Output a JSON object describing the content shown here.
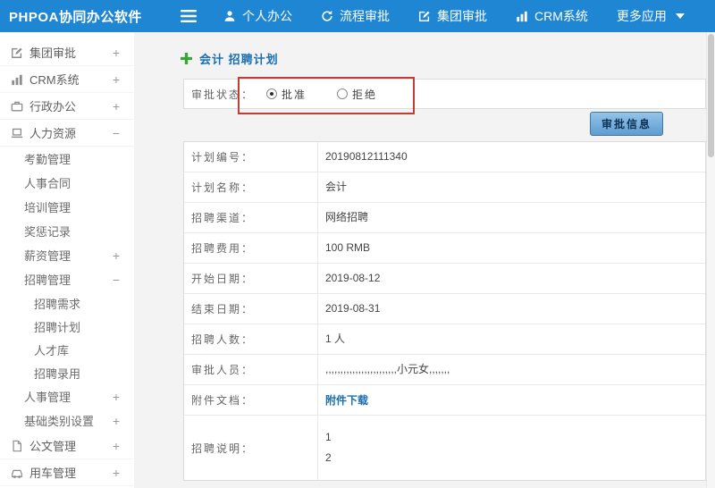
{
  "app": {
    "title": "PHPOA协同办公软件"
  },
  "topnav": {
    "items": [
      {
        "id": "personal-office",
        "label": "个人办公",
        "icon": "person-icon"
      },
      {
        "id": "workflow-approval",
        "label": "流程审批",
        "icon": "flow-icon"
      },
      {
        "id": "group-approval",
        "label": "集团审批",
        "icon": "edit-square-icon"
      },
      {
        "id": "crm-system",
        "label": "CRM系统",
        "icon": "bar-chart-icon"
      },
      {
        "id": "more-apps",
        "label": "更多应用",
        "caret": true
      }
    ]
  },
  "sidebar": {
    "items": [
      {
        "id": "group-approval",
        "label": "集团审批",
        "icon": "edit-square-icon",
        "toggle": "+",
        "level": 0
      },
      {
        "id": "crm-system",
        "label": "CRM系统",
        "icon": "bar-chart-icon",
        "toggle": "+",
        "level": 0
      },
      {
        "id": "admin-office",
        "label": "行政办公",
        "icon": "briefcase-icon",
        "toggle": "+",
        "level": 0
      },
      {
        "id": "human-resources",
        "label": "人力资源",
        "icon": "laptop-icon",
        "toggle": "−",
        "level": 0
      },
      {
        "id": "attendance-mgmt",
        "label": "考勤管理",
        "level": 1
      },
      {
        "id": "personnel-contract",
        "label": "人事合同",
        "level": 1
      },
      {
        "id": "training-mgmt",
        "label": "培训管理",
        "level": 1
      },
      {
        "id": "reward-punish-records",
        "label": "奖惩记录",
        "level": 1
      },
      {
        "id": "salary-mgmt",
        "label": "薪资管理",
        "toggle": "+",
        "level": 1
      },
      {
        "id": "recruit-mgmt",
        "label": "招聘管理",
        "toggle": "−",
        "level": 1
      },
      {
        "id": "recruit-demand",
        "label": "招聘需求",
        "level": 2
      },
      {
        "id": "recruit-plan",
        "label": "招聘计划",
        "level": 2
      },
      {
        "id": "talent-pool",
        "label": "人才库",
        "level": 2
      },
      {
        "id": "recruit-hire",
        "label": "招聘录用",
        "level": 2
      },
      {
        "id": "personnel-mgmt",
        "label": "人事管理",
        "toggle": "+",
        "level": 1
      },
      {
        "id": "base-category-settings",
        "label": "基础类别设置",
        "toggle": "+",
        "level": 1
      },
      {
        "id": "document-mgmt",
        "label": "公文管理",
        "icon": "document-icon",
        "toggle": "+",
        "level": 0
      },
      {
        "id": "vehicle-mgmt",
        "label": "用车管理",
        "icon": "car-icon",
        "toggle": "+",
        "level": 0
      }
    ]
  },
  "page": {
    "title": "会计 招聘计划"
  },
  "form": {
    "status_label": "审批状态：",
    "radios": [
      {
        "id": "approve",
        "label": "批准",
        "checked": true
      },
      {
        "id": "reject",
        "label": "拒绝",
        "checked": false
      }
    ],
    "approve_button": "审批信息",
    "rows": [
      {
        "id": "plan-number",
        "label": "计划编号：",
        "value": "20190812111340"
      },
      {
        "id": "plan-name",
        "label": "计划名称：",
        "value": "会计"
      },
      {
        "id": "recruit-channel",
        "label": "招聘渠道：",
        "value": "网络招聘"
      },
      {
        "id": "recruit-cost",
        "label": "招聘费用：",
        "value": "100 RMB"
      },
      {
        "id": "start-date",
        "label": "开始日期：",
        "value": "2019-08-12"
      },
      {
        "id": "end-date",
        "label": "结束日期：",
        "value": "2019-08-31"
      },
      {
        "id": "recruit-count",
        "label": "招聘人数：",
        "value": "1 人"
      },
      {
        "id": "approvers",
        "label": "审批人员：",
        "value": ",,,,,,,,,,,,,,,,,,,,,,,,小元女,,,,,,,"
      },
      {
        "id": "attachment",
        "label": "附件文档：",
        "value": "附件下载",
        "type": "link"
      },
      {
        "id": "recruit-description",
        "label": "招聘说明：",
        "value": "1\n2",
        "type": "multiline"
      }
    ]
  },
  "colors": {
    "topbar_blue": "#1e86d2",
    "accent_blue": "#1c6fae",
    "annotation_red": "#bf3f34",
    "plus_green": "#3aa33a"
  }
}
